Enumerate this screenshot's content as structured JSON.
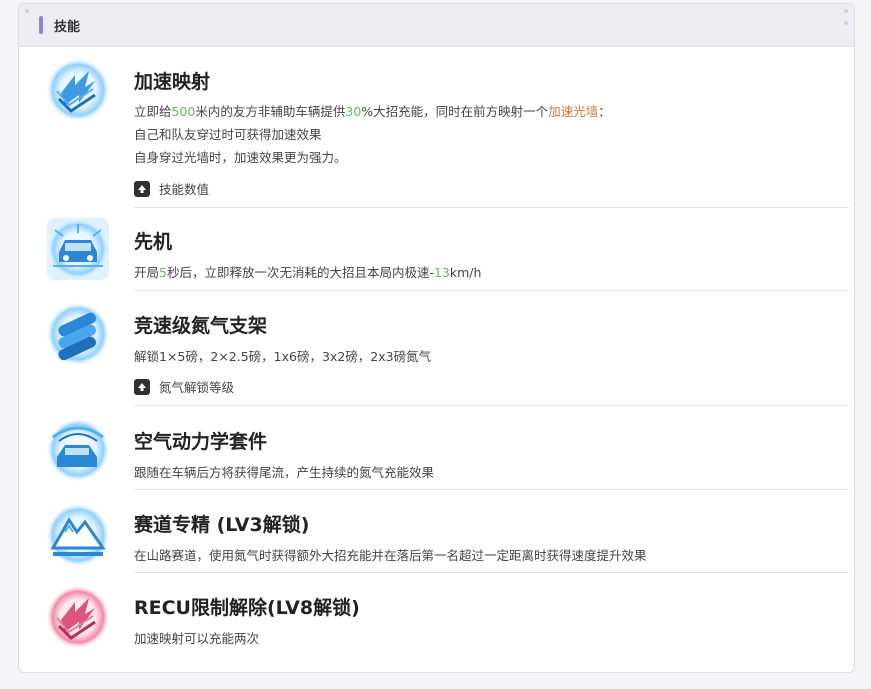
{
  "header": {
    "title": "技能"
  },
  "colors": {
    "accent": "#8e88c8",
    "highlight_green": "#6fb56a",
    "highlight_orange": "#c97a3c"
  },
  "skills": [
    {
      "icon": "accelerate-projection-icon",
      "name": "加速映射",
      "desc": {
        "l1_a": "立即给",
        "l1_b": "500",
        "l1_c": "米内的友方非辅助车辆提供",
        "l1_d": "30",
        "l1_e": "%大招充能，同时在前方映射一个",
        "l1_f": "加速光墙",
        "l1_g": "：",
        "l2": "自己和队友穿过时可获得加速效果",
        "l3": "自身穿过光墙时，加速效果更为强力。"
      },
      "toggle_label": "技能数值"
    },
    {
      "icon": "initiative-car-icon",
      "name": "先机",
      "desc": {
        "l1_a": "开局",
        "l1_b": "5",
        "l1_c": "秒后，立即释放一次无消耗的大招且本局内极速-",
        "l1_d": "13",
        "l1_e": "km/h"
      }
    },
    {
      "icon": "nitro-rack-icon",
      "name": "竞速级氮气支架",
      "desc": {
        "l1": "解锁1×5磅，2×2.5磅，1x6磅，3x2磅，2x3磅氮气"
      },
      "toggle_label": "氮气解锁等级"
    },
    {
      "icon": "aero-kit-icon",
      "name": "空气动力学套件",
      "desc": {
        "l1": "跟随在车辆后方将获得尾流，产生持续的氮气充能效果"
      }
    },
    {
      "icon": "mountain-track-icon",
      "name": "赛道专精 (LV3解锁)",
      "desc": {
        "l1": "在山路赛道，使用氮气时获得额外大招充能并在落后第一名超过一定距离时获得速度提升效果"
      }
    },
    {
      "icon": "recu-unlock-icon",
      "name": "RECU限制解除(LV8解锁)",
      "desc": {
        "l1": "加速映射可以充能两次"
      }
    }
  ]
}
